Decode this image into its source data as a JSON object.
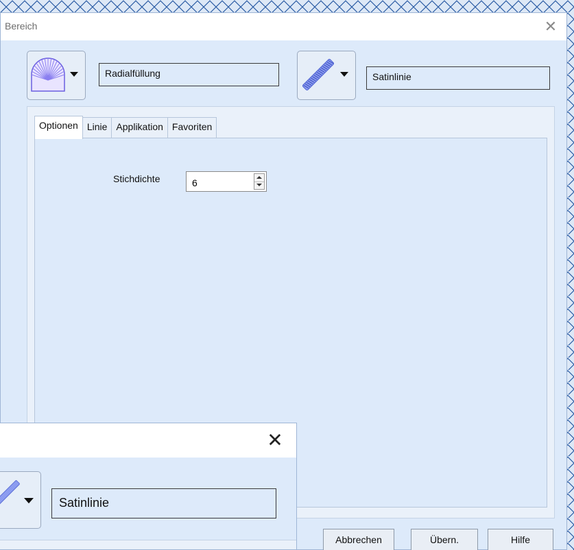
{
  "dialog": {
    "title": "Bereich",
    "close_glyph": "✕",
    "fill_type": {
      "icon": "radial-fill-icon",
      "name": "Radialfüllung"
    },
    "line_type": {
      "icon": "satin-line-icon",
      "name": "Satinlinie"
    },
    "tabs": [
      {
        "label": "Optionen",
        "active": true
      },
      {
        "label": "Linie",
        "active": false
      },
      {
        "label": "Applikation",
        "active": false
      },
      {
        "label": "Favoriten",
        "active": false
      }
    ],
    "options": {
      "stitch_density_label": "Stichdichte",
      "stitch_density_value": "6"
    },
    "buttons": {
      "cancel": "Abbrechen",
      "apply": "Übern.",
      "help": "Hilfe"
    }
  },
  "overlay_dialog": {
    "close_glyph": "✕",
    "line_type_name": "Satinlinie"
  },
  "colors": {
    "dialog_bg": "#ddeafa",
    "stitch_pattern": "#2f5fa6",
    "icon_violet": "#7c6ee6"
  }
}
